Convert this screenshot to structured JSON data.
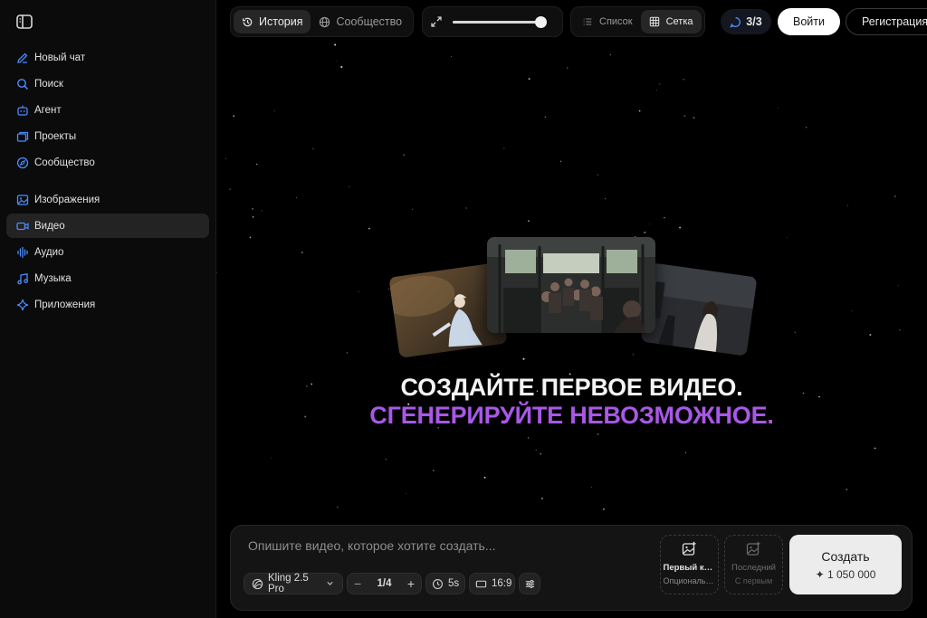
{
  "sidebar": {
    "items": [
      {
        "label": "Новый чат",
        "icon": "edit-icon"
      },
      {
        "label": "Поиск",
        "icon": "search-icon"
      },
      {
        "label": "Агент",
        "icon": "robot-icon"
      },
      {
        "label": "Проекты",
        "icon": "folder-icon"
      },
      {
        "label": "Сообщество",
        "icon": "compass-icon"
      },
      {
        "label": "Изображения",
        "icon": "image-icon"
      },
      {
        "label": "Видео",
        "icon": "video-icon",
        "active": true
      },
      {
        "label": "Аудио",
        "icon": "waveform-icon"
      },
      {
        "label": "Музыка",
        "icon": "music-note-icon"
      },
      {
        "label": "Приложения",
        "icon": "sparkle-icon"
      }
    ]
  },
  "topbar": {
    "history_label": "История",
    "community_label": "Сообщество",
    "zoom_level": 1.0,
    "list_label": "Список",
    "grid_label": "Сетка",
    "credits": "3/3",
    "login_label": "Войти",
    "register_label": "Регистрация"
  },
  "hero": {
    "line1": "СОЗДАЙТЕ ПЕРВОЕ ВИДЕО.",
    "line2": "СГЕНЕРИРУЙТЕ НЕВОЗМОЖНОЕ."
  },
  "composer": {
    "placeholder": "Опишите видео, которое хотите создать...",
    "model": "Kling 2.5 Pro",
    "count": "1/4",
    "duration": "5s",
    "aspect": "16:9",
    "first_frame_title": "Первый кадр",
    "first_frame_sub": "Опциональный",
    "last_frame_title": "Последний",
    "last_frame_sub": "С первым",
    "create_label": "Создать",
    "create_cost": "✦ 1 050 000"
  },
  "colors": {
    "accent_purple": "#a958e6",
    "background": "#000000",
    "sidebar_icon_blue": "#4a8cff"
  }
}
